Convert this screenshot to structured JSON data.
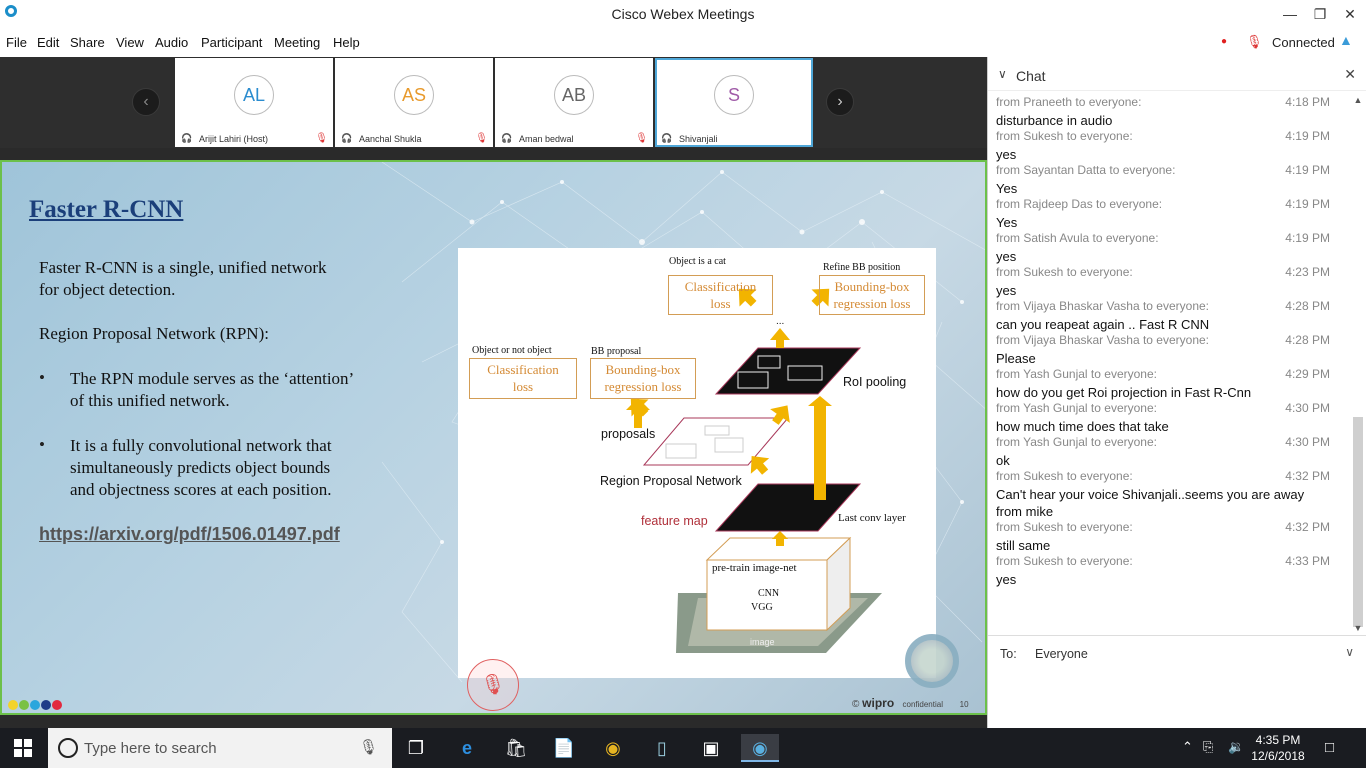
{
  "window": {
    "title": "Cisco Webex Meetings"
  },
  "menu": [
    "File",
    "Edit",
    "Share",
    "View",
    "Audio",
    "Participant",
    "Meeting",
    "Help"
  ],
  "status": {
    "connection": "Connected"
  },
  "participants": [
    {
      "initials": "AL",
      "name": "Arijit Lahiri (Host)",
      "color": "#2a8ccf"
    },
    {
      "initials": "AS",
      "name": "Aanchal Shukla",
      "color": "#e89a2c"
    },
    {
      "initials": "AB",
      "name": "Aman bedwal",
      "color": "#666666"
    },
    {
      "initials": "S",
      "name": "Shivanjali",
      "color": "#a05ca8"
    }
  ],
  "slide": {
    "title": "Faster R-CNN",
    "para1_line1": "Faster R-CNN is a single, unified network",
    "para1_line2": "for object detection.",
    "para2": "Region Proposal Network (RPN):",
    "bullet1_line1": "The RPN module serves as the ‘attention’",
    "bullet1_line2": "of this unified network.",
    "bullet2_line1": "It is a fully convolutional network that",
    "bullet2_line2": "simultaneously predicts object bounds",
    "bullet2_line3": "and objectness scores at each position.",
    "link": "https://arxiv.org/pdf/1506.01497.pdf",
    "footer_brand": "wipro",
    "footer_conf": "confidential",
    "footer_page": "10",
    "footer_copy": "©",
    "diagram": {
      "obj_cat": "Object is a cat",
      "refine_bb": "Refine BB position",
      "cls_loss_top_1": "Classification",
      "cls_loss_top_2": "loss",
      "bbox_top_1": "Bounding-box",
      "bbox_top_2": "regression loss",
      "obj_or_not": "Object or not object",
      "bb_proposal": "BB proposal",
      "cls_loss_left_1": "Classification",
      "cls_loss_left_2": "loss",
      "bbox_left_1": "Bounding-box",
      "bbox_left_2": "regression loss",
      "ellipsis": "...",
      "roi_pooling": "RoI pooling",
      "proposals": "proposals",
      "rpn": "Region Proposal Network",
      "feature_map": "feature map",
      "last_conv": "Last conv layer",
      "pretrain": "pre-train image-net",
      "cnn": "CNN",
      "vgg": "VGG",
      "image": "image"
    }
  },
  "chat": {
    "title": "Chat",
    "messages": [
      {
        "from": "from Praneeth to everyone:",
        "time": "4:18 PM",
        "text": "disturbance in audio"
      },
      {
        "from": "from Sukesh to everyone:",
        "time": "4:19 PM",
        "text": "yes"
      },
      {
        "from": "from Sayantan Datta to everyone:",
        "time": "4:19 PM",
        "text": "Yes"
      },
      {
        "from": "from Rajdeep Das to everyone:",
        "time": "4:19 PM",
        "text": "Yes"
      },
      {
        "from": "from Satish Avula to everyone:",
        "time": "4:19 PM",
        "text": "yes"
      },
      {
        "from": "from Sukesh to everyone:",
        "time": "4:23 PM",
        "text": "yes"
      },
      {
        "from": "from Vijaya Bhaskar Vasha to everyone:",
        "time": "4:28 PM",
        "text": "can you reapeat again ..  Fast R CNN"
      },
      {
        "from": "from Vijaya Bhaskar Vasha to everyone:",
        "time": "4:28 PM",
        "text": "Please"
      },
      {
        "from": "from Yash Gunjal to everyone:",
        "time": "4:29 PM",
        "text": "how do you get Roi projection in Fast R-Cnn"
      },
      {
        "from": "from Yash Gunjal to everyone:",
        "time": "4:30 PM",
        "text": "how much time does that take"
      },
      {
        "from": "from Yash Gunjal to everyone:",
        "time": "4:30 PM",
        "text": "ok"
      },
      {
        "from": "from Sukesh to everyone:",
        "time": "4:32 PM",
        "text": "Can't hear your voice Shivanjali..seems you are away from mike"
      },
      {
        "from": "from Sukesh to everyone:",
        "time": "4:32 PM",
        "text": "still same"
      },
      {
        "from": "from Sukesh to everyone:",
        "time": "4:33 PM",
        "text": "yes"
      }
    ],
    "to_label": "To:",
    "to_value": "Everyone"
  },
  "taskbar": {
    "search_placeholder": "Type here to search",
    "time": "4:35 PM",
    "date": "12/6/2018"
  }
}
